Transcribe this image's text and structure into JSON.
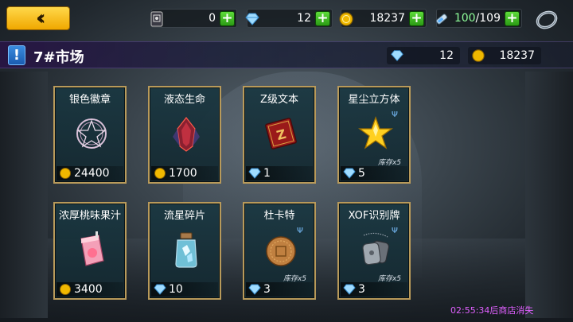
{
  "topbar": {
    "back_glyph": "‹‹",
    "resources": [
      {
        "name": "ticket",
        "value": "0",
        "icon": "ticket-icon"
      },
      {
        "name": "diamond",
        "value": "12",
        "icon": "diamond-icon"
      },
      {
        "name": "gold",
        "value": "18237",
        "icon": "gold-coin-icon"
      },
      {
        "name": "energy",
        "value": "100",
        "max": "/109",
        "icon": "battery-icon"
      }
    ],
    "plus_glyph": "+"
  },
  "title_bar": {
    "badge": "!",
    "title": "7#市场",
    "diamond": "12",
    "gold": "18237"
  },
  "items": [
    {
      "name": "银色徽章",
      "currency": "gold",
      "price": "24400",
      "stock": "",
      "icon": "pentagram-seal-icon"
    },
    {
      "name": "液态生命",
      "currency": "gold",
      "price": "1700",
      "stock": "",
      "icon": "red-crystal-icon"
    },
    {
      "name": "Z级文本",
      "currency": "diamond",
      "price": "1",
      "stock": "",
      "icon": "red-book-icon"
    },
    {
      "name": "星尘立方体",
      "currency": "diamond",
      "price": "5",
      "stock": "库存x5",
      "icon": "gold-star-icon"
    },
    {
      "name": "浓厚桃味果汁",
      "currency": "gold",
      "price": "3400",
      "stock": "",
      "icon": "juice-box-icon"
    },
    {
      "name": "流星碎片",
      "currency": "diamond",
      "price": "10",
      "stock": "",
      "icon": "crystal-jar-icon"
    },
    {
      "name": "杜卡特",
      "currency": "diamond",
      "price": "3",
      "stock": "库存x5",
      "icon": "bronze-coin-icon"
    },
    {
      "name": "XOF识别牌",
      "currency": "diamond",
      "price": "3",
      "stock": "库存x5",
      "icon": "dog-tag-icon"
    }
  ],
  "footer": {
    "timer": "02:55:34后商店消失"
  },
  "colors": {
    "gold": "#f0b800",
    "diamond": "#6cc4ff",
    "plus": "#3cbf22",
    "card_border": "#b89a5a",
    "timer": "#e060ff"
  }
}
